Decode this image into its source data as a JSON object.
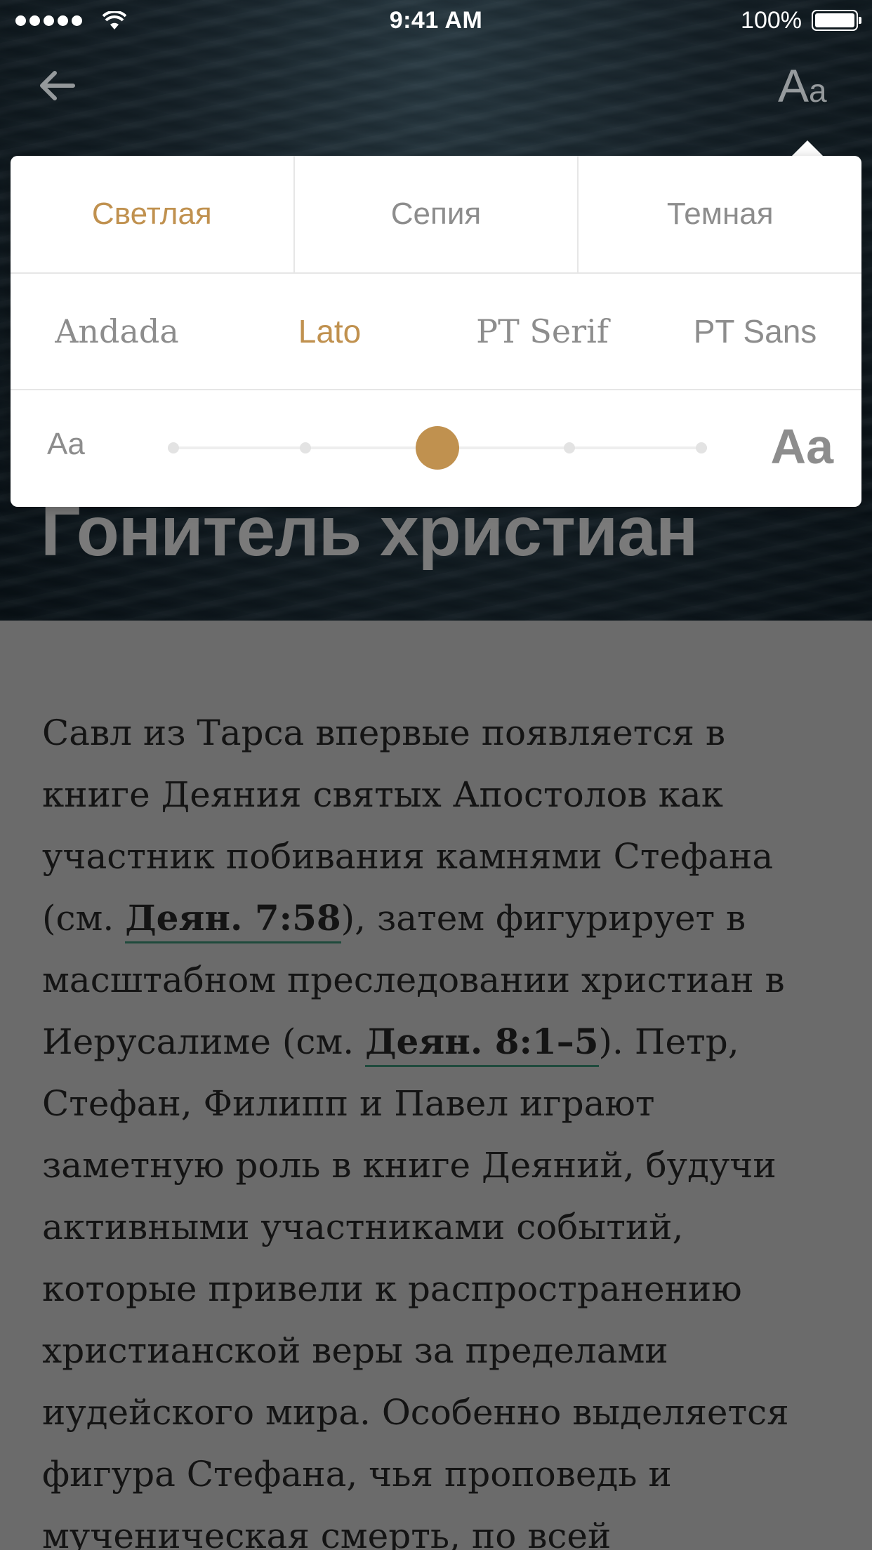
{
  "status_bar": {
    "time": "9:41 AM",
    "battery": "100%"
  },
  "header": {
    "back_icon": "arrow-left-icon",
    "font_settings_icon": "font-size-icon",
    "font_settings_big": "A",
    "font_settings_small": "a"
  },
  "hero": {
    "title": "Гонитель христиан"
  },
  "settings_popover": {
    "themes": [
      {
        "label": "Светлая",
        "active": true
      },
      {
        "label": "Сепия",
        "active": false
      },
      {
        "label": "Темная",
        "active": false
      }
    ],
    "fonts": [
      {
        "label": "Andada",
        "active": false
      },
      {
        "label": "Lato",
        "active": true
      },
      {
        "label": "PT Serif",
        "active": false
      },
      {
        "label": "PT Sans",
        "active": false
      }
    ],
    "size_small_label": "Aa",
    "size_large_label": "Aa",
    "size_steps": 5,
    "size_selected_step": 3
  },
  "article": {
    "line1": "Савл из Тарса впервые появляется в",
    "line2": "книге Деяния святых Апостолов как",
    "line3": "участник побивания камнями Стефана",
    "line4_pre": "(см. ",
    "line4_ref": "Деян. 7:58",
    "line4_post": "), затем фигурирует в",
    "line5": "масштабном преследовании христиан в",
    "line6_pre": "Иерусалиме (см. ",
    "line6_ref": "Деян. 8:1–5",
    "line6_post": "). Петр,",
    "line7": "Стефан, Филипп и Павел играют",
    "line8": "заметную роль в книге Деяний, будучи",
    "line9": "активными участниками событий,",
    "line10": "которые привели к распространению",
    "line11": "христианской веры за пределами",
    "line12": "иудейского мира. Особенно выделяется",
    "line13": "фигура Стефана, чья проповедь и",
    "line14": "мученическая смерть, по всей"
  },
  "colors": {
    "accent": "#c0914f",
    "inactive": "#8d8d8d",
    "overlay": "#6b6b6b",
    "link_underline": "#1f4a3c"
  }
}
